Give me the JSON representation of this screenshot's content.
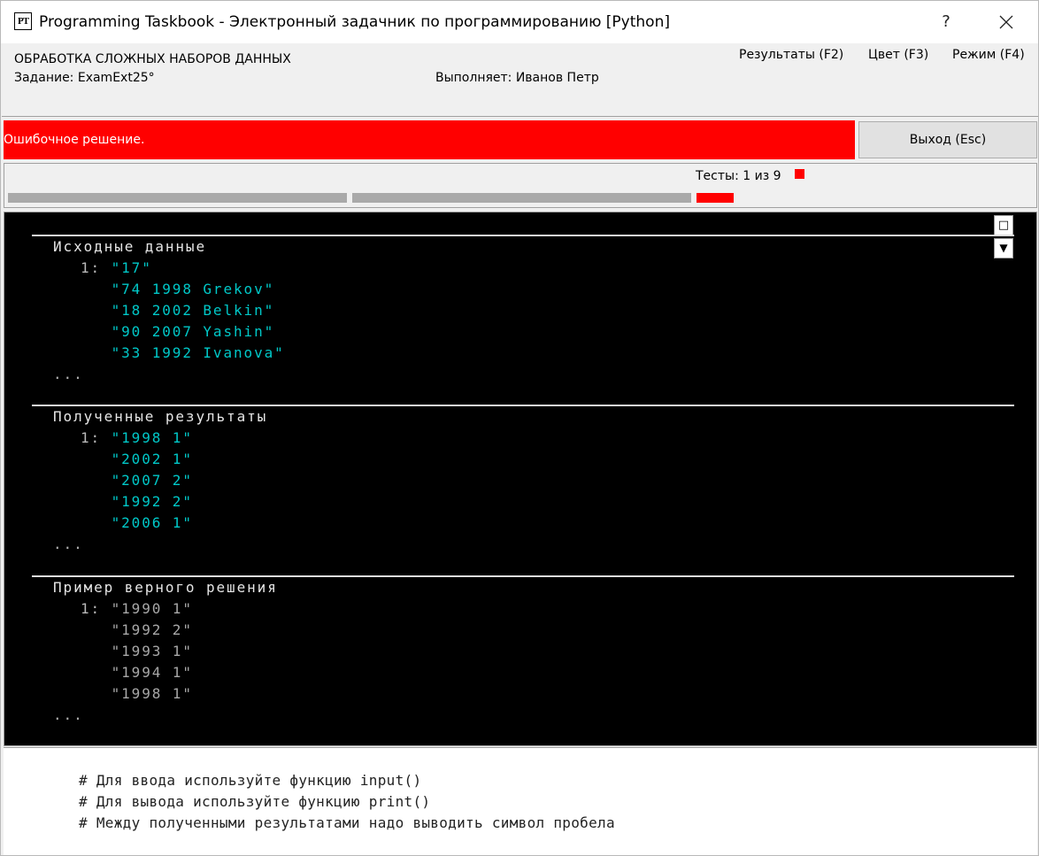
{
  "window": {
    "app_icon_text": "PT",
    "title": "Programming Taskbook - Электронный задачник по программированию [Python]",
    "help_label": "?",
    "close_icon": "close-icon"
  },
  "header": {
    "group_title": "ОБРАБОТКА СЛОЖНЫХ НАБОРОВ ДАННЫХ",
    "task": "Задание: ExamExt25°",
    "student": "Выполняет: Иванов Петр",
    "menu": {
      "results": "Результаты (F2)",
      "color": "Цвет (F3)",
      "mode": "Режим (F4)"
    }
  },
  "status": {
    "message": "Ошибочное решение.",
    "color": "#ff0000",
    "exit_label": "Выход (Esc)"
  },
  "tests": {
    "label": "Тесты:  1 из 9",
    "current": 1,
    "total": 9,
    "bar_colors": [
      "#a9a9a9",
      "#a9a9a9",
      "#ff0000"
    ]
  },
  "console": {
    "maximize_label": "□",
    "scroll_label": "▼",
    "sections": [
      {
        "title": "Исходные данные",
        "lines": [
          {
            "num": "1: ",
            "value": "\"17\""
          },
          {
            "num": "   ",
            "value": "\"74 1998 Grekov\""
          },
          {
            "num": "   ",
            "value": "\"18 2002 Belkin\""
          },
          {
            "num": "   ",
            "value": "\"90 2007 Yashin\""
          },
          {
            "num": "   ",
            "value": "\"33 1992 Ivanova\""
          }
        ],
        "ellipsis": "..."
      },
      {
        "title": "Полученные результаты",
        "lines": [
          {
            "num": "1: ",
            "value": "\"1998 1\""
          },
          {
            "num": "   ",
            "value": "\"2002 1\""
          },
          {
            "num": "   ",
            "value": "\"2007 2\""
          },
          {
            "num": "   ",
            "value": "\"1992 2\""
          },
          {
            "num": "   ",
            "value": "\"2006 1\""
          }
        ],
        "ellipsis": "..."
      },
      {
        "title": "Пример верного решения",
        "lines": [
          {
            "num": "1: ",
            "value": "\"1990 1\""
          },
          {
            "num": "   ",
            "value": "\"1992 2\""
          },
          {
            "num": "   ",
            "value": "\"1993 1\""
          },
          {
            "num": "   ",
            "value": "\"1994 1\""
          },
          {
            "num": "   ",
            "value": "\"1998 1\""
          }
        ],
        "ellipsis": "..."
      }
    ]
  },
  "comments": [
    "# Для ввода используйте функцию input()",
    "# Для вывода используйте функцию print()",
    "# Между полученными результатами надо выводить символ пробела"
  ]
}
